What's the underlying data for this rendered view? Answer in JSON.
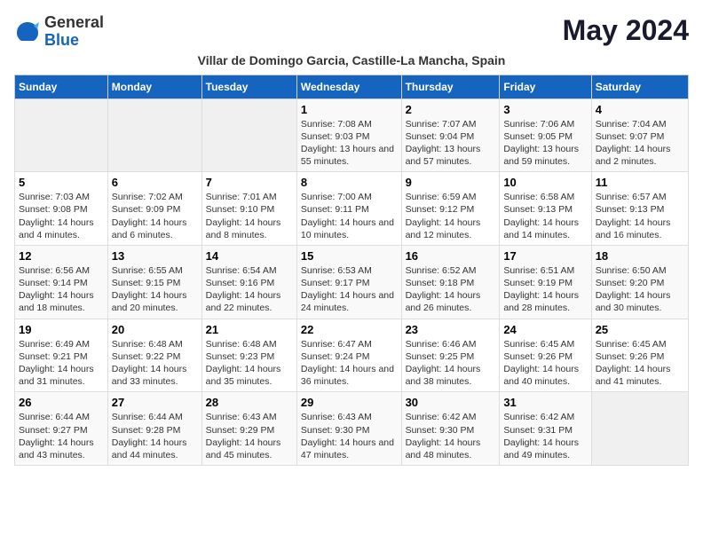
{
  "header": {
    "logo_general": "General",
    "logo_blue": "Blue",
    "title": "May 2024",
    "subtitle": "Villar de Domingo Garcia, Castille-La Mancha, Spain"
  },
  "days_of_week": [
    "Sunday",
    "Monday",
    "Tuesday",
    "Wednesday",
    "Thursday",
    "Friday",
    "Saturday"
  ],
  "weeks": [
    {
      "days": [
        {
          "num": "",
          "info": ""
        },
        {
          "num": "",
          "info": ""
        },
        {
          "num": "",
          "info": ""
        },
        {
          "num": "1",
          "info": "Sunrise: 7:08 AM\nSunset: 9:03 PM\nDaylight: 13 hours and 55 minutes."
        },
        {
          "num": "2",
          "info": "Sunrise: 7:07 AM\nSunset: 9:04 PM\nDaylight: 13 hours and 57 minutes."
        },
        {
          "num": "3",
          "info": "Sunrise: 7:06 AM\nSunset: 9:05 PM\nDaylight: 13 hours and 59 minutes."
        },
        {
          "num": "4",
          "info": "Sunrise: 7:04 AM\nSunset: 9:07 PM\nDaylight: 14 hours and 2 minutes."
        }
      ]
    },
    {
      "days": [
        {
          "num": "5",
          "info": "Sunrise: 7:03 AM\nSunset: 9:08 PM\nDaylight: 14 hours and 4 minutes."
        },
        {
          "num": "6",
          "info": "Sunrise: 7:02 AM\nSunset: 9:09 PM\nDaylight: 14 hours and 6 minutes."
        },
        {
          "num": "7",
          "info": "Sunrise: 7:01 AM\nSunset: 9:10 PM\nDaylight: 14 hours and 8 minutes."
        },
        {
          "num": "8",
          "info": "Sunrise: 7:00 AM\nSunset: 9:11 PM\nDaylight: 14 hours and 10 minutes."
        },
        {
          "num": "9",
          "info": "Sunrise: 6:59 AM\nSunset: 9:12 PM\nDaylight: 14 hours and 12 minutes."
        },
        {
          "num": "10",
          "info": "Sunrise: 6:58 AM\nSunset: 9:13 PM\nDaylight: 14 hours and 14 minutes."
        },
        {
          "num": "11",
          "info": "Sunrise: 6:57 AM\nSunset: 9:13 PM\nDaylight: 14 hours and 16 minutes."
        }
      ]
    },
    {
      "days": [
        {
          "num": "12",
          "info": "Sunrise: 6:56 AM\nSunset: 9:14 PM\nDaylight: 14 hours and 18 minutes."
        },
        {
          "num": "13",
          "info": "Sunrise: 6:55 AM\nSunset: 9:15 PM\nDaylight: 14 hours and 20 minutes."
        },
        {
          "num": "14",
          "info": "Sunrise: 6:54 AM\nSunset: 9:16 PM\nDaylight: 14 hours and 22 minutes."
        },
        {
          "num": "15",
          "info": "Sunrise: 6:53 AM\nSunset: 9:17 PM\nDaylight: 14 hours and 24 minutes."
        },
        {
          "num": "16",
          "info": "Sunrise: 6:52 AM\nSunset: 9:18 PM\nDaylight: 14 hours and 26 minutes."
        },
        {
          "num": "17",
          "info": "Sunrise: 6:51 AM\nSunset: 9:19 PM\nDaylight: 14 hours and 28 minutes."
        },
        {
          "num": "18",
          "info": "Sunrise: 6:50 AM\nSunset: 9:20 PM\nDaylight: 14 hours and 30 minutes."
        }
      ]
    },
    {
      "days": [
        {
          "num": "19",
          "info": "Sunrise: 6:49 AM\nSunset: 9:21 PM\nDaylight: 14 hours and 31 minutes."
        },
        {
          "num": "20",
          "info": "Sunrise: 6:48 AM\nSunset: 9:22 PM\nDaylight: 14 hours and 33 minutes."
        },
        {
          "num": "21",
          "info": "Sunrise: 6:48 AM\nSunset: 9:23 PM\nDaylight: 14 hours and 35 minutes."
        },
        {
          "num": "22",
          "info": "Sunrise: 6:47 AM\nSunset: 9:24 PM\nDaylight: 14 hours and 36 minutes."
        },
        {
          "num": "23",
          "info": "Sunrise: 6:46 AM\nSunset: 9:25 PM\nDaylight: 14 hours and 38 minutes."
        },
        {
          "num": "24",
          "info": "Sunrise: 6:45 AM\nSunset: 9:26 PM\nDaylight: 14 hours and 40 minutes."
        },
        {
          "num": "25",
          "info": "Sunrise: 6:45 AM\nSunset: 9:26 PM\nDaylight: 14 hours and 41 minutes."
        }
      ]
    },
    {
      "days": [
        {
          "num": "26",
          "info": "Sunrise: 6:44 AM\nSunset: 9:27 PM\nDaylight: 14 hours and 43 minutes."
        },
        {
          "num": "27",
          "info": "Sunrise: 6:44 AM\nSunset: 9:28 PM\nDaylight: 14 hours and 44 minutes."
        },
        {
          "num": "28",
          "info": "Sunrise: 6:43 AM\nSunset: 9:29 PM\nDaylight: 14 hours and 45 minutes."
        },
        {
          "num": "29",
          "info": "Sunrise: 6:43 AM\nSunset: 9:30 PM\nDaylight: 14 hours and 47 minutes."
        },
        {
          "num": "30",
          "info": "Sunrise: 6:42 AM\nSunset: 9:30 PM\nDaylight: 14 hours and 48 minutes."
        },
        {
          "num": "31",
          "info": "Sunrise: 6:42 AM\nSunset: 9:31 PM\nDaylight: 14 hours and 49 minutes."
        },
        {
          "num": "",
          "info": ""
        }
      ]
    }
  ]
}
